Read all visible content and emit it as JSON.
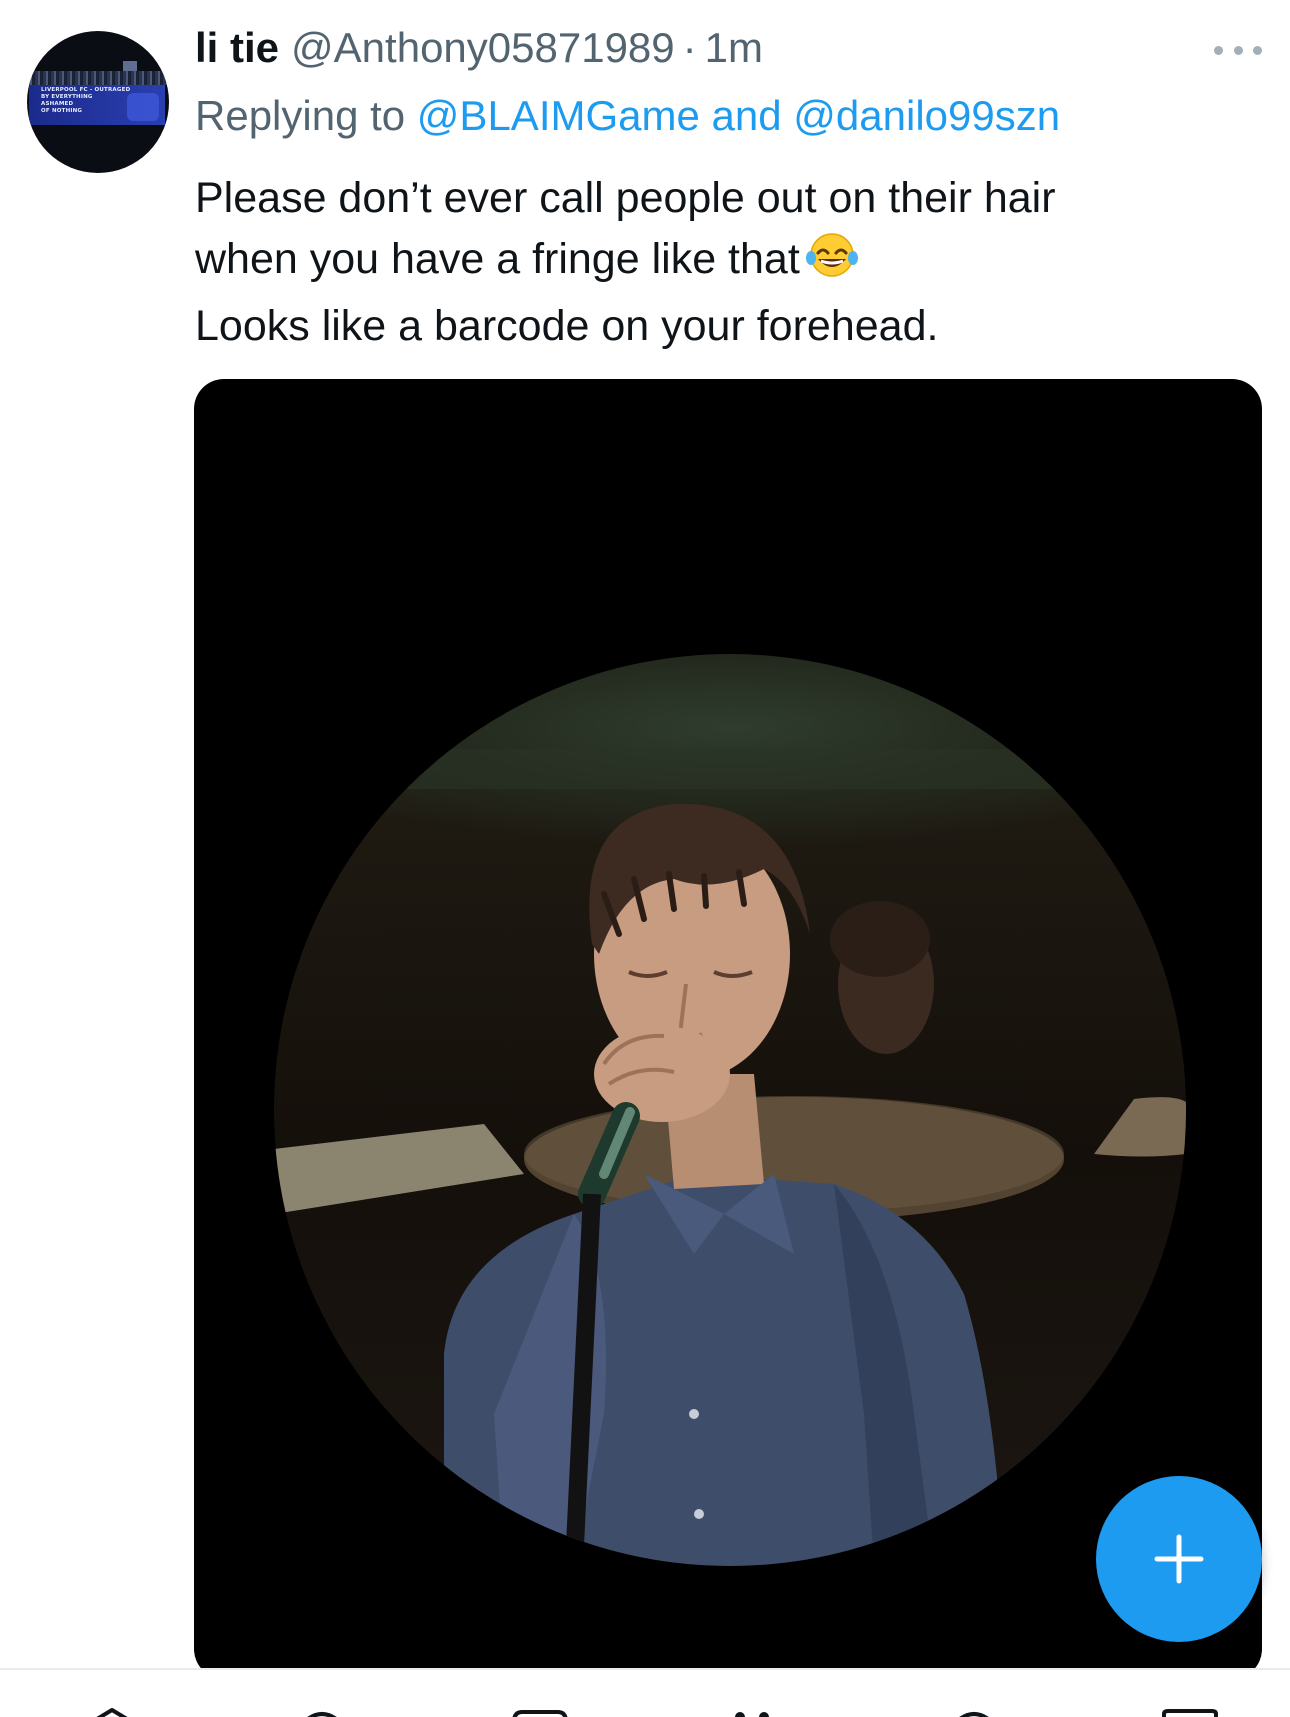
{
  "tweet": {
    "author_name": "li tie",
    "author_handle": "@Anthony05871989",
    "separator": "·",
    "time": "1m",
    "replying_prefix": "Replying to ",
    "reply_to_1": "@BLAIMGame",
    "reply_conjunction": " and ",
    "reply_to_2": "@danilo99szn",
    "text_lines": [
      "Please don’t ever call people out on their hair",
      "when you have a fringe like that",
      "Looks like a barcode on your forehead."
    ],
    "emoji": "face-with-tears-of-joy",
    "avatar_banner_lines": [
      "LIVERPOOL FC - OUTRAGED",
      "BY EVERYTHING",
      "ASHAMED",
      "OF NOTHING"
    ]
  },
  "fab": {
    "icon": "plus-icon"
  },
  "bottom_nav": {
    "icons": [
      "home-icon",
      "search-icon",
      "communities-icon",
      "spaces-icon",
      "notifications-icon",
      "messages-icon"
    ]
  },
  "colors": {
    "accent": "#1d9bf0",
    "text": "#0f1419",
    "secondary": "#536471"
  }
}
